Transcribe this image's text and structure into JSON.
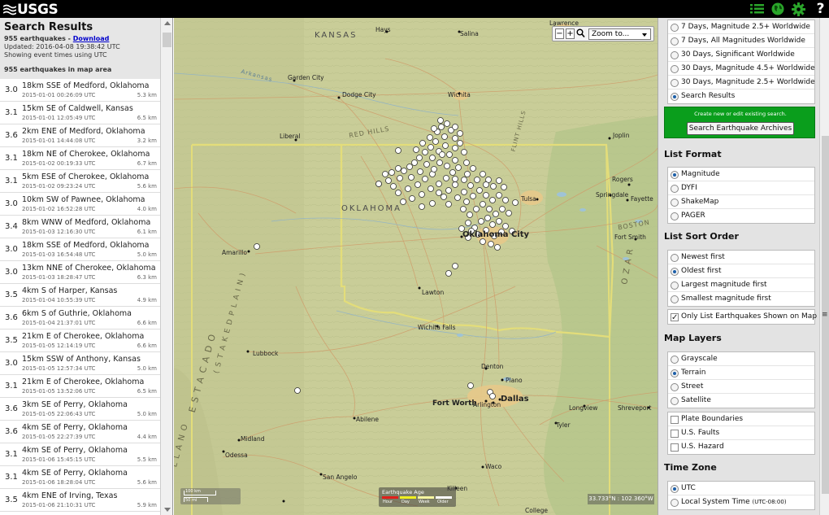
{
  "header": {
    "logo_text": "USGS",
    "icons": [
      "list-icon",
      "globe-icon",
      "gear-icon",
      "help-icon"
    ]
  },
  "results": {
    "title": "Search Results",
    "count_text": "955 earthquakes - ",
    "download_label": "Download",
    "updated": "Updated: 2016-04-08 19:38:42 UTC",
    "time_note": "Showing event times using UTC",
    "in_area": "955 earthquakes in map area"
  },
  "earthquakes": [
    {
      "mag": "3.0",
      "place": "18km SSE of Medford, Oklahoma",
      "time": "2015-01-01 00:26:09 UTC",
      "depth": "5.3 km"
    },
    {
      "mag": "3.1",
      "place": "15km SE of Caldwell, Kansas",
      "time": "2015-01-01 12:05:49 UTC",
      "depth": "6.5 km"
    },
    {
      "mag": "3.6",
      "place": "2km ENE of Medford, Oklahoma",
      "time": "2015-01-01 14:44:08 UTC",
      "depth": "3.2 km"
    },
    {
      "mag": "3.1",
      "place": "18km NE of Cherokee, Oklahoma",
      "time": "2015-01-02 00:19:33 UTC",
      "depth": "6.7 km"
    },
    {
      "mag": "3.1",
      "place": "5km ESE of Cherokee, Oklahoma",
      "time": "2015-01-02 09:23:24 UTC",
      "depth": "5.6 km"
    },
    {
      "mag": "3.0",
      "place": "10km SW of Pawnee, Oklahoma",
      "time": "2015-01-02 16:52:28 UTC",
      "depth": "4.0 km"
    },
    {
      "mag": "3.4",
      "place": "8km WNW of Medford, Oklahoma",
      "time": "2015-01-03 12:16:30 UTC",
      "depth": "6.1 km"
    },
    {
      "mag": "3.0",
      "place": "18km SSE of Medford, Oklahoma",
      "time": "2015-01-03 16:54:48 UTC",
      "depth": "5.0 km"
    },
    {
      "mag": "3.0",
      "place": "13km NNE of Cherokee, Oklahoma",
      "time": "2015-01-03 18:28:47 UTC",
      "depth": "6.3 km"
    },
    {
      "mag": "3.5",
      "place": "4km S of Harper, Kansas",
      "time": "2015-01-04 10:55:39 UTC",
      "depth": "4.9 km"
    },
    {
      "mag": "3.6",
      "place": "6km S of Guthrie, Oklahoma",
      "time": "2015-01-04 21:37:01 UTC",
      "depth": "6.6 km"
    },
    {
      "mag": "3.5",
      "place": "21km E of Cherokee, Oklahoma",
      "time": "2015-01-05 12:14:19 UTC",
      "depth": "6.6 km"
    },
    {
      "mag": "3.0",
      "place": "15km SSW of Anthony, Kansas",
      "time": "2015-01-05 12:57:34 UTC",
      "depth": "5.0 km"
    },
    {
      "mag": "3.1",
      "place": "21km E of Cherokee, Oklahoma",
      "time": "2015-01-05 13:52:06 UTC",
      "depth": "6.5 km"
    },
    {
      "mag": "3.6",
      "place": "3km SE of Perry, Oklahoma",
      "time": "2015-01-05 22:06:43 UTC",
      "depth": "5.0 km"
    },
    {
      "mag": "3.6",
      "place": "4km SE of Perry, Oklahoma",
      "time": "2015-01-05 22:27:39 UTC",
      "depth": "4.4 km"
    },
    {
      "mag": "3.1",
      "place": "4km SE of Perry, Oklahoma",
      "time": "2015-01-06 15:45:15 UTC",
      "depth": "5.5 km"
    },
    {
      "mag": "3.1",
      "place": "4km SE of Perry, Oklahoma",
      "time": "2015-01-06 18:28:04 UTC",
      "depth": "5.6 km"
    },
    {
      "mag": "3.5",
      "place": "4km ENE of Irving, Texas",
      "time": "2015-01-06 21:10:31 UTC",
      "depth": "5.9 km"
    }
  ],
  "map": {
    "zoom_label": "Zoom to...",
    "zoom_minus": "−",
    "zoom_plus": "+",
    "coords": "33.733°N : 102.360°W",
    "legend_title": "Earthquake Age",
    "legend_labels": [
      "Hour",
      "Day",
      "Week",
      "Older"
    ],
    "legend_colors": [
      "#e0201b",
      "#f0f020",
      "#f5f5a0",
      "#ffffff"
    ],
    "scale_text": "100 km",
    "scale_text2": "50 mi",
    "labels": {
      "kansas": "KANSAS",
      "oklahoma": "OKLAHOMA",
      "hays": "Hays",
      "salina": "Salina",
      "lawrence": "Lawrence",
      "garden_city": "Garden City",
      "dodge_city": "Dodge City",
      "wichita": "Wichita",
      "arkansas": "Arkansas",
      "red_hills": "RED HILLS",
      "flint_hills": "FLINT HILLS",
      "liberal": "Liberal",
      "joplin": "Joplin",
      "rogers": "Rogers",
      "springdale": "Springdale",
      "fayetteville": "Fayette",
      "tulsa": "Tulsa",
      "boston": "BOSTON",
      "fort_smith": "Fort Smith",
      "oklahoma_city": "Oklahoma City",
      "amarillo": "Amarillo",
      "lawton": "Lawton",
      "ozark": "O Z A R",
      "wichita_falls": "Wichita Falls",
      "lubbock": "Lubbock",
      "estacado": "E S T A C A D O",
      "staked_plain": "( S T A K E D   P L A I N )",
      "llano": "L L A N O",
      "denton": "Denton",
      "plano": "Plano",
      "fort_worth": "Fort Worth",
      "arlington": "Arlington",
      "dallas": "Dallas",
      "longview": "Longview",
      "shreveport": "Shreveport",
      "abilene": "Abilene",
      "tyler": "Tyler",
      "midland": "Midland",
      "odessa": "Odessa",
      "waco": "Waco",
      "san_angelo": "San Angelo",
      "killeen": "Killeen",
      "college": "College"
    }
  },
  "settings": {
    "feeds": [
      {
        "label": "7 Days, Magnitude 2.5+ Worldwide",
        "selected": false
      },
      {
        "label": "7 Days, All Magnitudes Worldwide",
        "selected": false
      },
      {
        "label": "30 Days, Significant Worldwide",
        "selected": false
      },
      {
        "label": "30 Days, Magnitude 4.5+ Worldwide",
        "selected": false
      },
      {
        "label": "30 Days, Magnitude 2.5+ Worldwide",
        "selected": false
      },
      {
        "label": "Search Results",
        "selected": true
      }
    ],
    "search_note": "Create new or edit existing search.",
    "search_button": "Search Earthquake Archives",
    "list_format_title": "List Format",
    "list_format": [
      {
        "label": "Magnitude",
        "selected": true
      },
      {
        "label": "DYFI",
        "selected": false
      },
      {
        "label": "ShakeMap",
        "selected": false
      },
      {
        "label": "PAGER",
        "selected": false
      }
    ],
    "sort_title": "List Sort Order",
    "sort_order": [
      {
        "label": "Newest first",
        "selected": false
      },
      {
        "label": "Oldest first",
        "selected": true
      },
      {
        "label": "Largest magnitude first",
        "selected": false
      },
      {
        "label": "Smallest magnitude first",
        "selected": false
      }
    ],
    "only_list_label": "Only List Earthquakes Shown on Map",
    "only_list_checked": true,
    "layers_title": "Map Layers",
    "layers": [
      {
        "label": "Grayscale",
        "selected": false
      },
      {
        "label": "Terrain",
        "selected": true
      },
      {
        "label": "Street",
        "selected": false
      },
      {
        "label": "Satellite",
        "selected": false
      }
    ],
    "overlays": [
      {
        "label": "Plate Boundaries",
        "checked": false
      },
      {
        "label": "U.S. Faults",
        "checked": false
      },
      {
        "label": "U.S. Hazard",
        "checked": false
      }
    ],
    "tz_title": "Time Zone",
    "tz_utc": "UTC",
    "tz_local": "Local System Time",
    "tz_local_note": "(UTC-08:00)",
    "tz_selected": "UTC"
  }
}
